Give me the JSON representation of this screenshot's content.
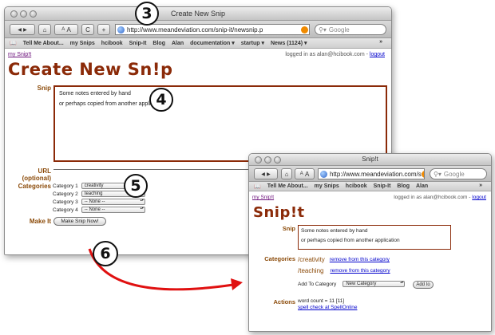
{
  "window1": {
    "title": "Create New Snip",
    "address": "http://www.meandeviation.com/snip-it/newsnip.p",
    "search_placeholder": "Google",
    "toolbar": {
      "back": "◀",
      "forward": "▶",
      "home": "⌂",
      "text_small": "A",
      "text_large": "A",
      "reload": "C",
      "add": "+"
    },
    "bookmarks": [
      "Tell Me About...",
      "my Snips",
      "hcibook",
      "Snip-It",
      "Blog",
      "Alan",
      "documentation ▾",
      "startup ▾",
      "News (1124) ▾"
    ],
    "bookmarks_more": "»",
    "my_snipit_link": "my Snip!t",
    "logged_in_text": "logged in as alan@hcibook.com",
    "logout_separator": "-",
    "logout_link": "logout",
    "page_title": "Create New Sn!p",
    "labels": {
      "snip": "Snip",
      "url": "URL",
      "url_optional": "(optional)",
      "categories": "Categories",
      "make_it": "Make It"
    },
    "snip_lines": [
      "Some notes entered by hand",
      "or perhaps copied from another application"
    ],
    "categories": [
      {
        "label": "Category 1",
        "value": "creativity"
      },
      {
        "label": "Category 2",
        "value": "teaching"
      },
      {
        "label": "Category 3",
        "value": "-- None --"
      },
      {
        "label": "Category 4",
        "value": "-- None --"
      }
    ],
    "make_button": "Make Snip Now!"
  },
  "window2": {
    "title": "Snip!t",
    "address": "http://www.meandeviation.com/s",
    "search_placeholder": "Google",
    "toolbar": {
      "back": "◀",
      "forward": "▶",
      "home": "⌂",
      "text_small": "A",
      "text_large": "A",
      "reload": "C",
      "add": "+"
    },
    "bookmarks": [
      "Tell Me About...",
      "my Snips",
      "hcibook",
      "Snip-It",
      "Blog",
      "Alan"
    ],
    "bookmarks_more": "»",
    "my_snipit_link": "my Snip!t",
    "logged_in_text": "logged in as alan@hcibook.com",
    "logout_separator": "-",
    "logout_link": "logout",
    "page_title": "Snip!t",
    "labels": {
      "snip": "Snip",
      "categories": "Categories",
      "actions": "Actions"
    },
    "snip_lines": [
      "Some notes entered by hand",
      "or perhaps copied from another application"
    ],
    "category_items": [
      {
        "name": "/creativity",
        "action": "remove from this category"
      },
      {
        "name": "/teaching",
        "action": "remove from this category"
      }
    ],
    "add_to_category_label": "Add To Category",
    "add_to_category_value": "New Category",
    "add_button": "Add to",
    "word_count": "word count = 11 [11]",
    "spell_check_link": "spell check at SpellOnline"
  },
  "callouts": [
    "3",
    "4",
    "5",
    "6"
  ],
  "colors": {
    "title_brown": "#8b2a08",
    "label_brown": "#8b4a08",
    "arrow_red": "#e01010",
    "link_blue": "#0000cc"
  }
}
